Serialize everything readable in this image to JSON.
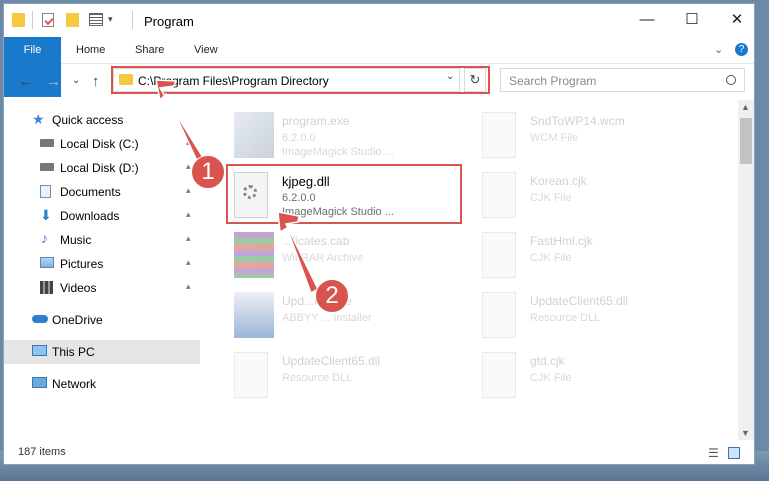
{
  "window": {
    "title": "Program",
    "controls": {
      "minimize": "—",
      "maximize": "☐",
      "close": "✕"
    }
  },
  "ribbon": {
    "tabs": [
      "File",
      "Home",
      "Share",
      "View"
    ],
    "expand": "⌄",
    "help": "?"
  },
  "address": {
    "path": "C:\\Program Files\\Program Directory",
    "search_placeholder": "Search Program",
    "nav": {
      "back": "←",
      "forward": "→",
      "recent": "⌄",
      "up": "↑"
    },
    "dropdown": "⌄",
    "refresh": "↻"
  },
  "sidebar": {
    "items": [
      {
        "label": "Quick access",
        "icon": "star-icon",
        "pinned": false
      },
      {
        "label": "Local Disk (C:)",
        "icon": "drive-icon",
        "pinned": true
      },
      {
        "label": "Local Disk (D:)",
        "icon": "drive-icon",
        "pinned": true
      },
      {
        "label": "Documents",
        "icon": "documents-icon",
        "pinned": true
      },
      {
        "label": "Downloads",
        "icon": "downloads-icon",
        "pinned": true
      },
      {
        "label": "Music",
        "icon": "music-icon",
        "pinned": true
      },
      {
        "label": "Pictures",
        "icon": "pictures-icon",
        "pinned": true
      },
      {
        "label": "Videos",
        "icon": "videos-icon",
        "pinned": true
      },
      {
        "label": "OneDrive",
        "icon": "cloud-icon",
        "pinned": false
      },
      {
        "label": "This PC",
        "icon": "pc-icon",
        "pinned": false,
        "selected": true
      },
      {
        "label": "Network",
        "icon": "network-icon",
        "pinned": false
      }
    ],
    "pin_glyph": "📌"
  },
  "files": [
    {
      "name": "program.exe",
      "meta1": "6.2.0.0",
      "meta2": "ImageMagick Studio ..."
    },
    {
      "name": "SndToWP14.wcm",
      "meta1": "WCM File",
      "meta2": ""
    },
    {
      "name": "kjpeg.dll",
      "meta1": "6.2.0.0",
      "meta2": "ImageMagick Studio ..."
    },
    {
      "name": "Korean.cjk",
      "meta1": "CJK File",
      "meta2": ""
    },
    {
      "name": "...ficates.cab",
      "meta1": "WinRAR Archive",
      "meta2": ""
    },
    {
      "name": "FastHml.cjk",
      "meta1": "CJK File",
      "meta2": ""
    },
    {
      "name": "Upd...ller.exe",
      "meta1": "ABBYY ... installer",
      "meta2": ""
    },
    {
      "name": "UpdateClient65.dll",
      "meta1": "Resource DLL",
      "meta2": ""
    },
    {
      "name": "UpdateClient65.dll",
      "meta1": "Resource DLL",
      "meta2": ""
    },
    {
      "name": "gtd.cjk",
      "meta1": "CJK File",
      "meta2": ""
    }
  ],
  "status": {
    "count": "187 items"
  },
  "callouts": {
    "one": "1",
    "two": "2"
  },
  "colors": {
    "accent": "#1979ca",
    "highlight": "#d9534f",
    "selected": "#e5e5e5"
  }
}
